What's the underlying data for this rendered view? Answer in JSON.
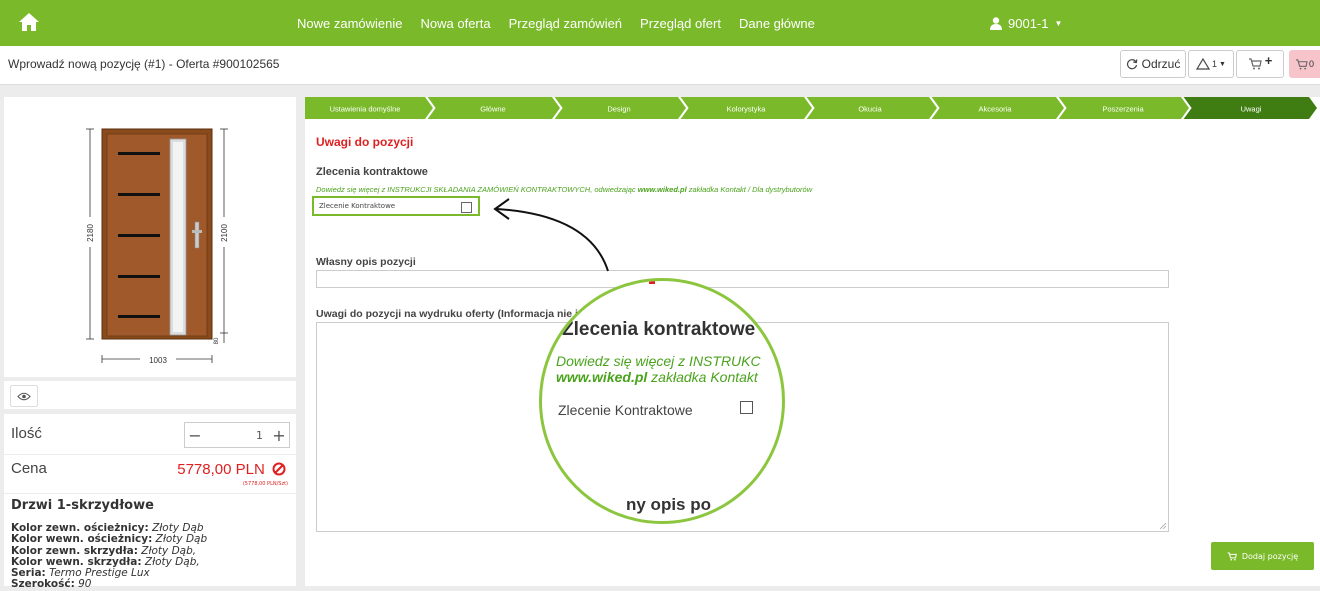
{
  "topbar": {
    "nav": [
      "Nowe zamówienie",
      "Nowa oferta",
      "Przegląd zamówień",
      "Przegląd ofert",
      "Dane główne"
    ],
    "user": "9001-1",
    "bg_color": "#7ab929"
  },
  "subbar": {
    "title": "Wprowadź nową pozycję (#1) - Oferta #900102565",
    "reject_label": "Odrzuć",
    "warnings_count": "1",
    "cart_count": "0"
  },
  "drawing": {
    "width_dim": "1003",
    "height_frame": "2180",
    "height_leaf": "2100",
    "bottom_dim": "80"
  },
  "quantity": {
    "label": "Ilość",
    "value": "1",
    "minus": "−",
    "plus": "+"
  },
  "price": {
    "label": "Cena",
    "value": "5778,00 PLN",
    "sub": "(5778,00 PLN/Szt)"
  },
  "product": {
    "name": "Drzwi 1-skrzydłowe",
    "properties": [
      {
        "key": "Kolor zewn. ościeżnicy:",
        "val": "Złoty Dąb"
      },
      {
        "key": "Kolor wewn. ościeżnicy:",
        "val": "Złoty Dąb"
      },
      {
        "key": "Kolor zewn. skrzydła:",
        "val": "Złoty Dąb,"
      },
      {
        "key": "Kolor wewn. skrzydła:",
        "val": "Złoty Dąb,"
      },
      {
        "key": "Seria:",
        "val": "Termo Prestige Lux"
      },
      {
        "key": "Szerokość:",
        "val": "90"
      }
    ]
  },
  "steps": [
    "Ustawienia domyślne",
    "Główne",
    "Design",
    "Kolorystyka",
    "Okucia",
    "Akcesoria",
    "Poszerzenia",
    "Uwagi"
  ],
  "section": {
    "title": "Uwagi do pozycji",
    "contract_heading": "Zlecenia kontraktowe",
    "info_prefix": "Dowiedz się więcej z INSTRUKCJI SKŁADANIA ZAMÓWIEŃ KONTRAKTOWYCH, odwiedzając ",
    "info_link": "www.wiked.pl",
    "info_suffix": " zakładka Kontakt / Dla dystrybutorów",
    "checkbox_label": "Zlecenie Kontraktowe",
    "own_desc_label": "Własny opis pozycji",
    "remarks_label": "Uwagi do pozycji na wydruku oferty (Informacja nie je",
    "add_button": "Dodaj pozycję"
  },
  "magnifier": {
    "heading": "Zlecenia kontraktowe",
    "line1": "Dowiedz się więcej z INSTRUKC",
    "link": "www.wiked.pl",
    "line2_suffix": " zakładka Kontakt",
    "checkbox_label": "Zlecenie Kontraktowe",
    "bottom": "ny opis po"
  }
}
